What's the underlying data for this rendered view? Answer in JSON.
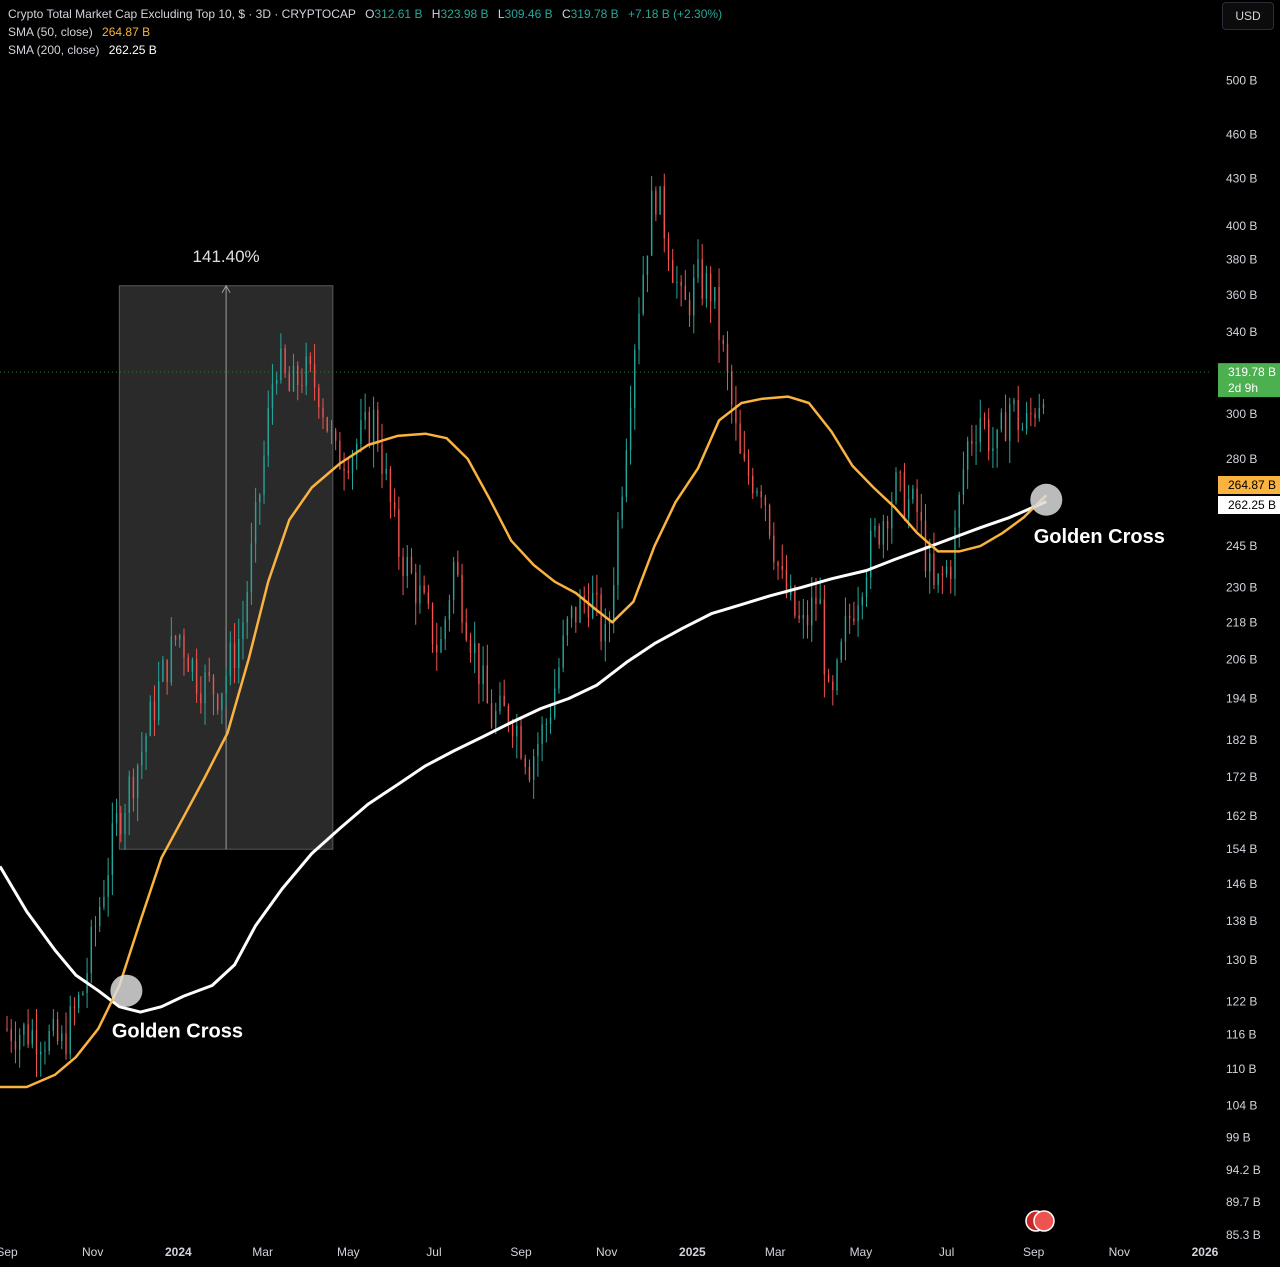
{
  "legend": {
    "title": "Crypto Total Market Cap Excluding Top 10, $ · 3D · CRYPTOCAP",
    "o_label": "O",
    "o_value": "312.61 B",
    "h_label": "H",
    "h_value": "323.98 B",
    "l_label": "L",
    "l_value": "309.46 B",
    "c_label": "C",
    "c_value": "319.78 B",
    "change": "+7.18 B (+2.30%)",
    "sma50_label": "SMA (50, close)",
    "sma50_value": "264.87 B",
    "sma200_label": "SMA (200, close)",
    "sma200_value": "262.25 B"
  },
  "currency_button": "USD",
  "colors": {
    "up": "#26a69a",
    "down": "#ef5350",
    "sma50": "#f9b33e",
    "sma200": "#ffffff",
    "background": "#000000",
    "axis_text": "#d1d4dc",
    "last_price": "#4caf50"
  },
  "chart_data": {
    "type": "candlestick",
    "title": "Crypto Total Market Cap Excluding Top 10",
    "y_scale": "log",
    "ylim": [
      85.3,
      540
    ],
    "xlim": [
      "2023-08-27",
      "2026-01-06"
    ],
    "x_tick_labels": [
      {
        "date": "2023-09-01",
        "label": "Sep"
      },
      {
        "date": "2023-11-01",
        "label": "Nov"
      },
      {
        "date": "2024-01-01",
        "label": "2024"
      },
      {
        "date": "2024-03-01",
        "label": "Mar"
      },
      {
        "date": "2024-05-01",
        "label": "May"
      },
      {
        "date": "2024-07-01",
        "label": "Jul"
      },
      {
        "date": "2024-09-01",
        "label": "Sep"
      },
      {
        "date": "2024-11-01",
        "label": "Nov"
      },
      {
        "date": "2025-01-01",
        "label": "2025"
      },
      {
        "date": "2025-03-01",
        "label": "Mar"
      },
      {
        "date": "2025-05-01",
        "label": "May"
      },
      {
        "date": "2025-07-01",
        "label": "Jul"
      },
      {
        "date": "2025-09-01",
        "label": "Sep"
      },
      {
        "date": "2025-11-01",
        "label": "Nov"
      },
      {
        "date": "2026-01-01",
        "label": "2026"
      }
    ],
    "y_tick_labels": [
      {
        "value": 500,
        "label": "500 B"
      },
      {
        "value": 460,
        "label": "460 B"
      },
      {
        "value": 430,
        "label": "430 B"
      },
      {
        "value": 400,
        "label": "400 B"
      },
      {
        "value": 380,
        "label": "380 B"
      },
      {
        "value": 360,
        "label": "360 B"
      },
      {
        "value": 340,
        "label": "340 B"
      },
      {
        "value": 300,
        "label": "300 B"
      },
      {
        "value": 280,
        "label": "280 B"
      },
      {
        "value": 245,
        "label": "245 B"
      },
      {
        "value": 230,
        "label": "230 B"
      },
      {
        "value": 218,
        "label": "218 B"
      },
      {
        "value": 206,
        "label": "206 B"
      },
      {
        "value": 194,
        "label": "194 B"
      },
      {
        "value": 182,
        "label": "182 B"
      },
      {
        "value": 172,
        "label": "172 B"
      },
      {
        "value": 162,
        "label": "162 B"
      },
      {
        "value": 154,
        "label": "154 B"
      },
      {
        "value": 146,
        "label": "146 B"
      },
      {
        "value": 138,
        "label": "138 B"
      },
      {
        "value": 130,
        "label": "130 B"
      },
      {
        "value": 122,
        "label": "122 B"
      },
      {
        "value": 116,
        "label": "116 B"
      },
      {
        "value": 110,
        "label": "110 B"
      },
      {
        "value": 104,
        "label": "104 B"
      },
      {
        "value": 99,
        "label": "99 B"
      },
      {
        "value": 94.2,
        "label": "94.2 B"
      },
      {
        "value": 89.7,
        "label": "89.7 B"
      },
      {
        "value": 85.3,
        "label": "85.3 B"
      }
    ],
    "price_path": [
      [
        "2023-09-01",
        117
      ],
      [
        "2023-09-25",
        116
      ],
      [
        "2023-10-10",
        114
      ],
      [
        "2023-10-25",
        124
      ],
      [
        "2023-11-05",
        140
      ],
      [
        "2023-11-18",
        160
      ],
      [
        "2023-12-05",
        178
      ],
      [
        "2023-12-20",
        200
      ],
      [
        "2024-01-01",
        215
      ],
      [
        "2024-01-15",
        200
      ],
      [
        "2024-01-30",
        196
      ],
      [
        "2024-02-15",
        215
      ],
      [
        "2024-03-01",
        275
      ],
      [
        "2024-03-10",
        328
      ],
      [
        "2024-03-20",
        310
      ],
      [
        "2024-03-30",
        320
      ],
      [
        "2024-04-10",
        312
      ],
      [
        "2024-04-22",
        280
      ],
      [
        "2024-05-05",
        285
      ],
      [
        "2024-05-20",
        298
      ],
      [
        "2024-06-05",
        245
      ],
      [
        "2024-06-20",
        228
      ],
      [
        "2024-07-05",
        208
      ],
      [
        "2024-07-15",
        238
      ],
      [
        "2024-08-01",
        205
      ],
      [
        "2024-08-10",
        188
      ],
      [
        "2024-08-25",
        190
      ],
      [
        "2024-09-07",
        176
      ],
      [
        "2024-09-20",
        188
      ],
      [
        "2024-10-05",
        218
      ],
      [
        "2024-10-20",
        228
      ],
      [
        "2024-11-01",
        210
      ],
      [
        "2024-11-12",
        272
      ],
      [
        "2024-11-22",
        345
      ],
      [
        "2024-12-05",
        425
      ],
      [
        "2024-12-15",
        390
      ],
      [
        "2024-12-25",
        350
      ],
      [
        "2025-01-05",
        368
      ],
      [
        "2025-01-15",
        362
      ],
      [
        "2025-01-25",
        320
      ],
      [
        "2025-02-05",
        275
      ],
      [
        "2025-02-20",
        270
      ],
      [
        "2025-03-05",
        232
      ],
      [
        "2025-03-20",
        215
      ],
      [
        "2025-04-01",
        228
      ],
      [
        "2025-04-09",
        188
      ],
      [
        "2025-04-20",
        215
      ],
      [
        "2025-05-05",
        240
      ],
      [
        "2025-05-25",
        268
      ],
      [
        "2025-06-10",
        258
      ],
      [
        "2025-06-22",
        228
      ],
      [
        "2025-07-05",
        240
      ],
      [
        "2025-07-15",
        285
      ],
      [
        "2025-07-25",
        300
      ],
      [
        "2025-08-05",
        282
      ],
      [
        "2025-08-15",
        305
      ],
      [
        "2025-08-25",
        292
      ],
      [
        "2025-09-05",
        308
      ],
      [
        "2025-09-10",
        319.78
      ]
    ],
    "sma50": [
      [
        "2023-08-27",
        107
      ],
      [
        "2023-09-15",
        107
      ],
      [
        "2023-10-05",
        109
      ],
      [
        "2023-10-20",
        112
      ],
      [
        "2023-11-05",
        117
      ],
      [
        "2023-11-20",
        125
      ],
      [
        "2023-12-05",
        138
      ],
      [
        "2023-12-20",
        152
      ],
      [
        "2024-01-05",
        162
      ],
      [
        "2024-01-20",
        172
      ],
      [
        "2024-02-05",
        184
      ],
      [
        "2024-02-20",
        206
      ],
      [
        "2024-03-05",
        232
      ],
      [
        "2024-03-20",
        255
      ],
      [
        "2024-04-05",
        268
      ],
      [
        "2024-04-25",
        278
      ],
      [
        "2024-05-15",
        286
      ],
      [
        "2024-06-05",
        290
      ],
      [
        "2024-06-25",
        291
      ],
      [
        "2024-07-10",
        289
      ],
      [
        "2024-07-25",
        280
      ],
      [
        "2024-08-10",
        263
      ],
      [
        "2024-08-25",
        247
      ],
      [
        "2024-09-10",
        238
      ],
      [
        "2024-09-25",
        232
      ],
      [
        "2024-10-10",
        228
      ],
      [
        "2024-10-25",
        222
      ],
      [
        "2024-11-05",
        218
      ],
      [
        "2024-11-20",
        225
      ],
      [
        "2024-12-05",
        245
      ],
      [
        "2024-12-20",
        262
      ],
      [
        "2025-01-05",
        276
      ],
      [
        "2025-01-20",
        297
      ],
      [
        "2025-02-05",
        305
      ],
      [
        "2025-02-20",
        307
      ],
      [
        "2025-03-10",
        308
      ],
      [
        "2025-03-25",
        305
      ],
      [
        "2025-04-10",
        292
      ],
      [
        "2025-04-25",
        277
      ],
      [
        "2025-05-10",
        268
      ],
      [
        "2025-05-25",
        260
      ],
      [
        "2025-06-10",
        250
      ],
      [
        "2025-06-25",
        243
      ],
      [
        "2025-07-10",
        243
      ],
      [
        "2025-07-25",
        245
      ],
      [
        "2025-08-10",
        250
      ],
      [
        "2025-08-25",
        256
      ],
      [
        "2025-09-10",
        264.87
      ]
    ],
    "sma200": [
      [
        "2023-08-27",
        150
      ],
      [
        "2023-09-15",
        140
      ],
      [
        "2023-10-05",
        132
      ],
      [
        "2023-10-20",
        127
      ],
      [
        "2023-11-05",
        124
      ],
      [
        "2023-11-20",
        121
      ],
      [
        "2023-12-05",
        120
      ],
      [
        "2023-12-20",
        121
      ],
      [
        "2024-01-05",
        123
      ],
      [
        "2024-01-25",
        125
      ],
      [
        "2024-02-10",
        129
      ],
      [
        "2024-02-25",
        137
      ],
      [
        "2024-03-15",
        145
      ],
      [
        "2024-04-05",
        153
      ],
      [
        "2024-04-25",
        159
      ],
      [
        "2024-05-15",
        165
      ],
      [
        "2024-06-05",
        170
      ],
      [
        "2024-06-25",
        175
      ],
      [
        "2024-07-15",
        179
      ],
      [
        "2024-08-05",
        183
      ],
      [
        "2024-08-25",
        187
      ],
      [
        "2024-09-15",
        191
      ],
      [
        "2024-10-05",
        194
      ],
      [
        "2024-10-25",
        198
      ],
      [
        "2024-11-15",
        205
      ],
      [
        "2024-12-05",
        211
      ],
      [
        "2024-12-25",
        216
      ],
      [
        "2025-01-15",
        221
      ],
      [
        "2025-02-05",
        224
      ],
      [
        "2025-02-25",
        227
      ],
      [
        "2025-03-20",
        230
      ],
      [
        "2025-04-10",
        233
      ],
      [
        "2025-05-05",
        236
      ],
      [
        "2025-05-25",
        240
      ],
      [
        "2025-06-15",
        244
      ],
      [
        "2025-07-05",
        248
      ],
      [
        "2025-07-25",
        252
      ],
      [
        "2025-08-15",
        256
      ],
      [
        "2025-09-10",
        262.25
      ]
    ],
    "last_price": {
      "value": 319.78,
      "label": "319.78 B",
      "countdown": "2d 9h"
    },
    "sma_tags": [
      {
        "name": "SMA 50",
        "value": 264.87,
        "label": "264.87 B"
      },
      {
        "name": "SMA 200",
        "value": 262.25,
        "label": "262.25 B"
      }
    ],
    "range_measure": {
      "start_date": "2023-11-20",
      "end_date": "2024-04-20",
      "low": 154,
      "high": 365,
      "label": "141.40%"
    },
    "annotations": [
      {
        "text": "Golden Cross",
        "date": "2023-11-25",
        "value": 124
      },
      {
        "text": "Golden Cross",
        "date": "2025-09-10",
        "value": 263
      }
    ]
  }
}
